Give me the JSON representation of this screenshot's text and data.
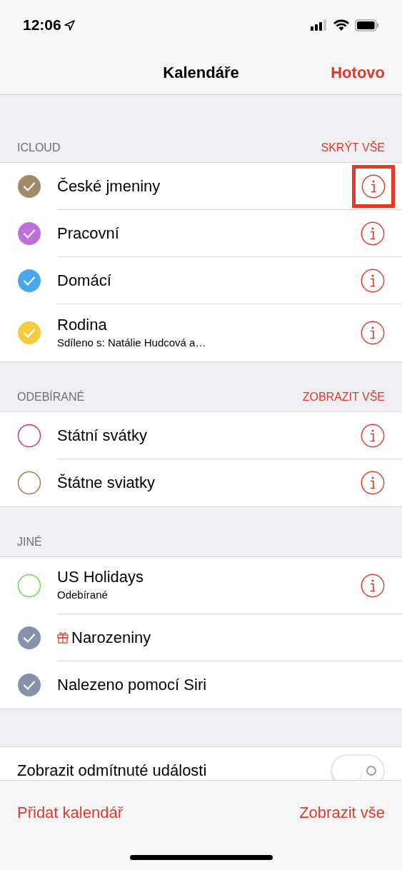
{
  "status_bar": {
    "time": "12:06"
  },
  "nav": {
    "title": "Kalendáře",
    "done": "Hotovo"
  },
  "sections": [
    {
      "title": "ICLOUD",
      "action": "SKRÝT VŠE",
      "items": [
        {
          "name": "České jmeniny",
          "color": "#a08a67",
          "checked": true,
          "info": true,
          "highlighted": true
        },
        {
          "name": "Pracovní",
          "color": "#be6fdc",
          "checked": true,
          "info": true,
          "highlighted": false
        },
        {
          "name": "Domácí",
          "color": "#49a7ee",
          "checked": true,
          "info": true,
          "highlighted": false
        },
        {
          "name": "Rodina",
          "subtitle": "Sdíleno s: Natálie Hudcová a…",
          "color": "#f5cc3f",
          "checked": true,
          "info": true,
          "highlighted": false
        }
      ]
    },
    {
      "title": "ODEBÍRANÉ",
      "action": "ZOBRAZIT VŠE",
      "items": [
        {
          "name": "Státní svátky",
          "color": "#d8365e",
          "checked": false,
          "info": true,
          "highlighted": false
        },
        {
          "name": "Štátne sviatky",
          "color": "#9a7f55",
          "checked": false,
          "info": true,
          "highlighted": false
        }
      ]
    },
    {
      "title": "JINÉ",
      "items": [
        {
          "name": "US Holidays",
          "subtitle": "Odebírané",
          "color": "#6fd64a",
          "checked": false,
          "info": true,
          "highlighted": false
        },
        {
          "name": "Narozeniny",
          "gift": true,
          "color": "#8691aa",
          "checked": true,
          "info": false,
          "highlighted": false
        },
        {
          "name": "Nalezeno pomocí Siri",
          "color": "#8691aa",
          "checked": true,
          "info": false,
          "highlighted": false
        }
      ]
    }
  ],
  "setting": {
    "label": "Zobrazit odmítnuté události",
    "on": false
  },
  "toolbar": {
    "left": "Přidat kalendář",
    "right": "Zobrazit vše"
  }
}
